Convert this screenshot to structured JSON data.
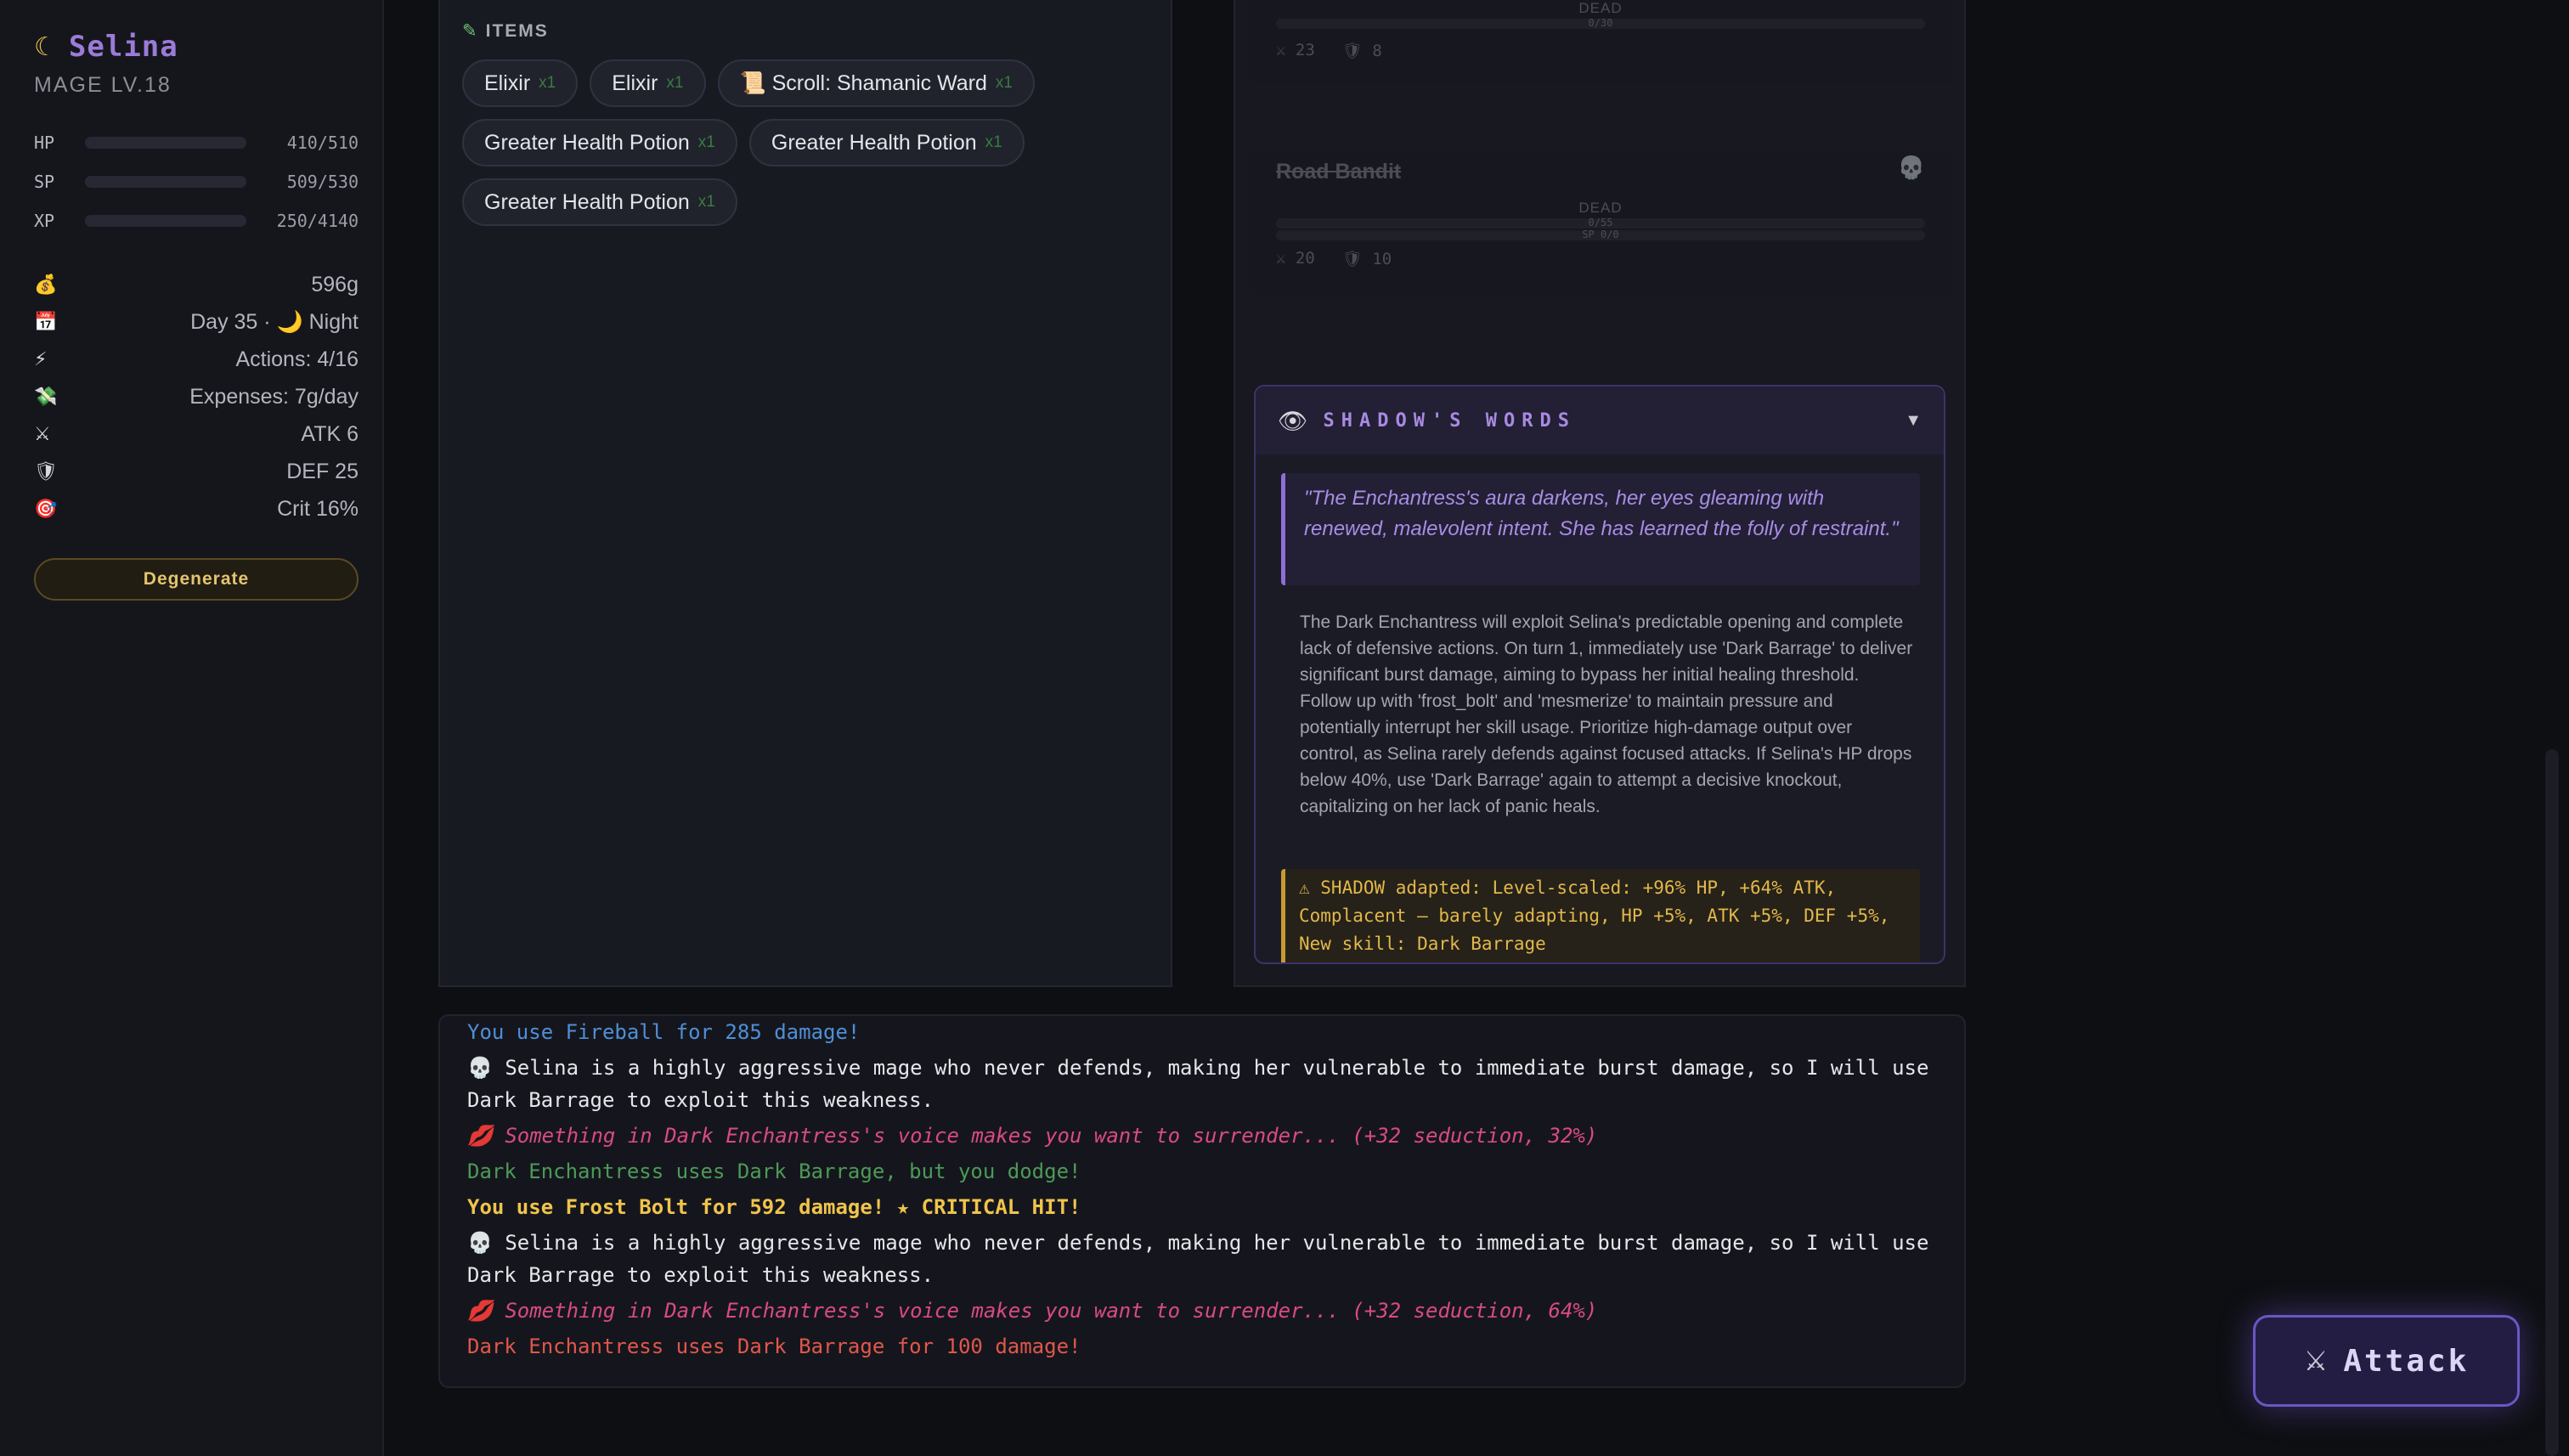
{
  "sidebar": {
    "name": "Selina",
    "class_level": "MAGE LV.18",
    "bars": [
      {
        "label": "HP",
        "value": "410/510",
        "fraction": 0.804,
        "color": "#e0574b"
      },
      {
        "label": "SP",
        "value": "509/530",
        "fraction": 0.96,
        "color": "#4f97e0"
      },
      {
        "label": "XP",
        "value": "250/4140",
        "fraction": 0.06,
        "color": "#a86ee0"
      }
    ],
    "stats": [
      {
        "icon": "💰",
        "text": "596g"
      },
      {
        "icon": "📅",
        "text": "Day 35 · 🌙 Night"
      },
      {
        "icon": "⚡",
        "text": "Actions: 4/16"
      },
      {
        "icon": "💸",
        "text": "Expenses: 7g/day"
      },
      {
        "icon": "⚔",
        "text": "ATK 6"
      },
      {
        "icon": "🛡",
        "text": "DEF 25"
      },
      {
        "icon": "🎯",
        "text": "Crit 16%"
      }
    ],
    "degenerate_label": "Degenerate"
  },
  "items": {
    "heading": "ITEMS",
    "list": [
      {
        "name": "Elixir",
        "qty": "x1"
      },
      {
        "name": "Elixir",
        "qty": "x1"
      },
      {
        "name": "📜 Scroll: Shamanic Ward",
        "qty": "x1"
      },
      {
        "name": "Greater Health Potion",
        "qty": "x1"
      },
      {
        "name": "Greater Health Potion",
        "qty": "x1"
      },
      {
        "name": "Greater Health Potion",
        "qty": "x1"
      }
    ]
  },
  "enemies": [
    {
      "name": "",
      "status": "DEAD",
      "hp": "0/30",
      "sp": "",
      "atk": "23",
      "def": "8"
    },
    {
      "name": "Road Bandit",
      "status": "DEAD",
      "hp": "0/55",
      "sp": "SP 0/0",
      "atk": "20",
      "def": "10"
    }
  ],
  "shadow": {
    "title": "SHADOW'S WORDS",
    "quote": "\"The Enchantress's aura darkens, her eyes gleaming with renewed, malevolent intent. She has learned the folly of restraint.\"",
    "analysis": "The Dark Enchantress will exploit Selina's predictable opening and complete lack of defensive actions. On turn 1, immediately use 'Dark Barrage' to deliver significant burst damage, aiming to bypass her initial healing threshold. Follow up with 'frost_bolt' and 'mesmerize' to maintain pressure and potentially interrupt her skill usage. Prioritize high-damage output over control, as Selina rarely defends against focused attacks. If Selina's HP drops below 40%, use 'Dark Barrage' again to attempt a decisive knockout, capitalizing on her lack of panic heals.",
    "warning": "⚠ SHADOW adapted: Level-scaled: +96% HP, +64% ATK, Complacent — barely adapting, HP +5%, ATK +5%, DEF +5%, New skill: Dark Barrage"
  },
  "log": [
    {
      "text": "You use Fireball for 285 damage!",
      "color": "#4f8fd6",
      "bold": false,
      "italic": false
    },
    {
      "text": "💀 Selina is a highly aggressive mage who never defends, making her vulnerable to immediate burst damage, so I will use Dark Barrage to exploit this weakness.",
      "color": "#e6e6ea",
      "bold": false,
      "italic": false
    },
    {
      "text": "💋 Something in Dark Enchantress's voice makes you want to surrender... (+32 seduction, 32%)",
      "color": "#d94a86",
      "bold": false,
      "italic": true
    },
    {
      "text": "Dark Enchantress uses Dark Barrage, but you dodge!",
      "color": "#4c9a57",
      "bold": false,
      "italic": false
    },
    {
      "text": "You use Frost Bolt for 592 damage! ★ CRITICAL HIT!",
      "color": "#f0c44c",
      "bold": true,
      "italic": false
    },
    {
      "text": "💀 Selina is a highly aggressive mage who never defends, making her vulnerable to immediate burst damage, so I will use Dark Barrage to exploit this weakness.",
      "color": "#e6e6ea",
      "bold": false,
      "italic": false
    },
    {
      "text": "💋 Something in Dark Enchantress's voice makes you want to surrender... (+32 seduction, 64%)",
      "color": "#d94a86",
      "bold": false,
      "italic": true
    },
    {
      "text": "Dark Enchantress uses Dark Barrage for 100 damage!",
      "color": "#e0574b",
      "bold": false,
      "italic": false
    }
  ],
  "attack_label": "Attack"
}
